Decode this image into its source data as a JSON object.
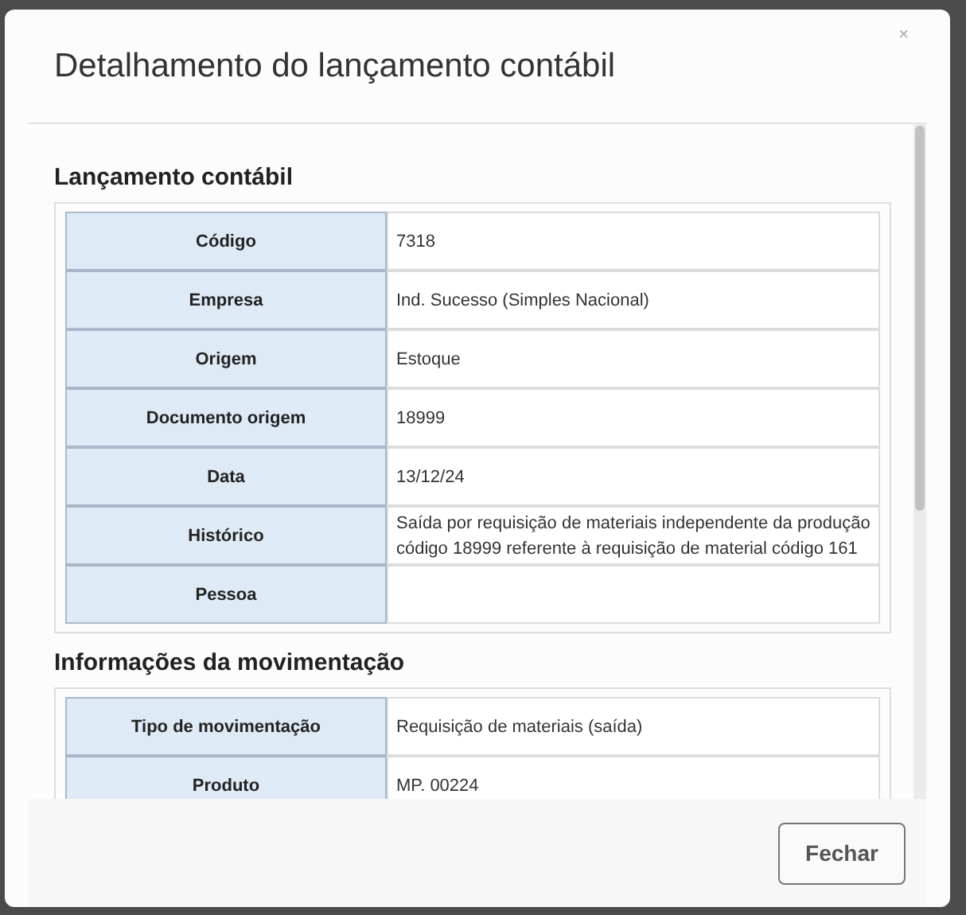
{
  "dialog": {
    "title": "Detalhamento do lançamento contábil",
    "close": "×"
  },
  "sections": [
    {
      "title": "Lançamento contábil",
      "rows": [
        {
          "label": "Código",
          "value": "7318"
        },
        {
          "label": "Empresa",
          "value": "Ind. Sucesso (Simples Nacional)"
        },
        {
          "label": "Origem",
          "value": "Estoque"
        },
        {
          "label": "Documento origem",
          "value": "18999"
        },
        {
          "label": "Data",
          "value": "13/12/24"
        },
        {
          "label": "Histórico",
          "value": "Saída por requisição de materiais independente da produção código 18999 referente à requisição de material código 161"
        },
        {
          "label": "Pessoa"
        }
      ]
    },
    {
      "title": "Informações da movimentação",
      "rows": [
        {
          "label": "Tipo de movimentação",
          "value": "Requisição de materiais (saída)"
        },
        {
          "label": "Produto",
          "value": "MP. 00224"
        }
      ]
    }
  ],
  "footer": {
    "buttons": [
      "Fechar"
    ]
  }
}
